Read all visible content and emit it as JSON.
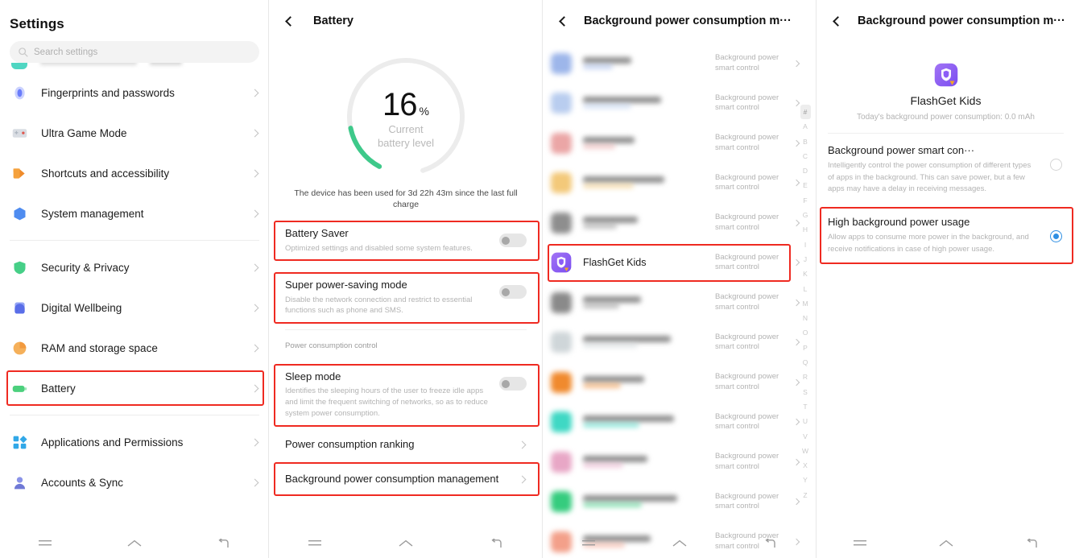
{
  "accent": {
    "red_highlight": "#ef2a21",
    "battery_green": "#3ec98a",
    "radio_blue": "#2f8fe3"
  },
  "panel1": {
    "title": "Settings",
    "search": {
      "placeholder": "Search settings",
      "icon": "search-icon"
    },
    "group_a": [
      {
        "label": "Fingerprints and passwords",
        "icon": "fingerprint-icon",
        "color": "#6a7dfb"
      },
      {
        "label": "Ultra Game Mode",
        "icon": "gamepad-icon",
        "color": "#d9dde3"
      },
      {
        "label": "Shortcuts and accessibility",
        "icon": "shortcut-arrow-icon",
        "color": "#f5a13c"
      },
      {
        "label": "System management",
        "icon": "hexagon-icon",
        "color": "#4f8cf0"
      }
    ],
    "group_b": [
      {
        "label": "Security & Privacy",
        "icon": "shield-icon",
        "color": "#46cf87"
      },
      {
        "label": "Digital Wellbeing",
        "icon": "wellbeing-icon",
        "color": "#6a7dfb"
      },
      {
        "label": "RAM and storage space",
        "icon": "pie-icon",
        "color": "#f5b05a"
      },
      {
        "label": "Battery",
        "icon": "battery-icon",
        "color": "#4cd07d",
        "highlighted": true
      }
    ],
    "group_c": [
      {
        "label": "Applications and Permissions",
        "icon": "apps-grid-icon",
        "color": "#31a8e8"
      },
      {
        "label": "Accounts & Sync",
        "icon": "person-icon",
        "color": "#8a93e8"
      }
    ]
  },
  "panel2": {
    "title": "Battery",
    "back_icon": "back-chevron-icon",
    "battery": {
      "percent": "16",
      "percent_symbol": "%",
      "caption_line1": "Current",
      "caption_line2": "battery  level",
      "usage_note": "The device has been used for 3d 22h 43m since the last full charge",
      "arc_fraction": 0.16
    },
    "cards": [
      {
        "title": "Battery Saver",
        "desc": "Optimized settings and disabled some system features.",
        "toggle": "off",
        "highlighted": true
      },
      {
        "title": "Super power-saving mode",
        "desc": "Disable the network connection and restrict to essential functions such as phone and SMS.",
        "toggle": "off",
        "highlighted": true
      }
    ],
    "section_label": "Power consumption control",
    "sleep_card": {
      "title": "Sleep mode",
      "desc": "Identifies the sleeping hours of the user to freeze idle apps and limit the frequent switching of networks, so as to reduce system power consumption.",
      "toggle": "off",
      "highlighted": true
    },
    "nav_rows": [
      {
        "label": "Power consumption ranking",
        "highlighted": false
      },
      {
        "label": "Background power consumption management",
        "highlighted": true
      }
    ]
  },
  "panel3": {
    "title": "Background power consumption m···",
    "back_icon": "back-chevron-icon",
    "status_text": "Background power smart control",
    "rows": [
      {
        "name": "",
        "redacted": true,
        "icon_color": "#9db6ea"
      },
      {
        "name": "",
        "redacted": true,
        "icon_color": "#b9cdef"
      },
      {
        "name": "",
        "redacted": true,
        "icon_color": "#eba6a6"
      },
      {
        "name": "",
        "redacted": true,
        "icon_color": "#f3c97a"
      },
      {
        "name": "",
        "redacted": true,
        "icon_color": "#8e8e8e"
      },
      {
        "name": "FlashGet Kids",
        "redacted": false,
        "icon_color": "#8b5cf6",
        "highlighted": true
      },
      {
        "name": "",
        "redacted": true,
        "icon_color": "#8a8a8a"
      },
      {
        "name": "",
        "redacted": true,
        "icon_color": "#cfd6d9"
      },
      {
        "name": "",
        "redacted": true,
        "icon_color": "#f08a2e"
      },
      {
        "name": "",
        "redacted": true,
        "icon_color": "#3fd8c4"
      },
      {
        "name": "",
        "redacted": true,
        "icon_color": "#e8a7c6"
      },
      {
        "name": "",
        "redacted": true,
        "icon_color": "#35cc7e"
      },
      {
        "name": "",
        "redacted": true,
        "icon_color": "#f3a08a"
      }
    ],
    "alphabet": [
      "#",
      "A",
      "B",
      "C",
      "D",
      "E",
      "F",
      "G",
      "H",
      "I",
      "J",
      "K",
      "L",
      "M",
      "N",
      "O",
      "P",
      "Q",
      "R",
      "S",
      "T",
      "U",
      "V",
      "W",
      "X",
      "Y",
      "Z"
    ],
    "alphabet_active": "#"
  },
  "panel4": {
    "title": "Background power consumption m···",
    "back_icon": "back-chevron-icon",
    "app": {
      "name": "FlashGet Kids",
      "icon_color": "#8b5cf6",
      "consumption": "Today's background power consumption: 0.0 mAh"
    },
    "options": [
      {
        "title": "Background power smart con···",
        "desc": "Intelligently control the power consumption of different types of apps in the background. This can save power, but a few apps may have a delay in receiving messages.",
        "selected": false,
        "highlighted": false
      },
      {
        "title": "High background power usage",
        "desc": "Allow apps to consume more power in the background, and receive notifications in case of high power usage.",
        "selected": true,
        "highlighted": true
      }
    ]
  },
  "navbar": {
    "recents": "recents-icon",
    "home": "home-icon",
    "back": "back-arrow-icon"
  }
}
